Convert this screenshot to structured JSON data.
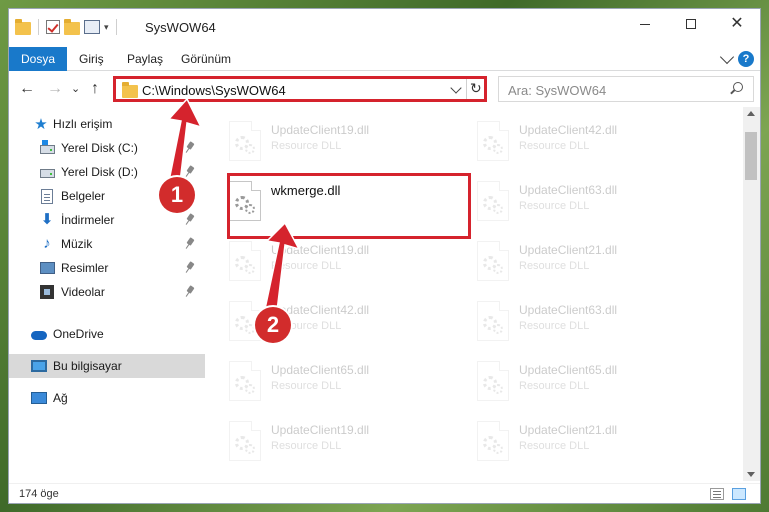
{
  "window": {
    "title": "SysWOW64",
    "qat_dropdown": "▾"
  },
  "ribbon": {
    "tabs": [
      {
        "label": "Dosya",
        "active": true
      },
      {
        "label": "Giriş",
        "active": false
      },
      {
        "label": "Paylaş",
        "active": false
      },
      {
        "label": "Görünüm",
        "active": false
      }
    ],
    "help": "?"
  },
  "nav": {
    "back": "←",
    "forward": "→",
    "recent": "⌄",
    "up": "↑",
    "address": "C:\\Windows\\SysWOW64",
    "refresh": "↻",
    "search_placeholder": "Ara: SysWOW64"
  },
  "sidebar": {
    "items": [
      {
        "label": "Hızlı erişim",
        "icon": "star-icon"
      },
      {
        "label": "Yerel Disk (C:)",
        "icon": "drive-icon",
        "pinned": true
      },
      {
        "label": "Yerel Disk (D:)",
        "icon": "drive-icon",
        "pinned": true
      },
      {
        "label": "Belgeler",
        "icon": "document-icon",
        "pinned": true
      },
      {
        "label": "İndirmeler",
        "icon": "download-icon",
        "pinned": true
      },
      {
        "label": "Müzik",
        "icon": "music-icon",
        "pinned": true
      },
      {
        "label": "Resimler",
        "icon": "pictures-icon",
        "pinned": true
      },
      {
        "label": "Videolar",
        "icon": "videos-icon",
        "pinned": true
      },
      {
        "label": "OneDrive",
        "icon": "cloud-icon"
      },
      {
        "label": "Bu bilgisayar",
        "icon": "computer-icon",
        "selected": true
      },
      {
        "label": "Ağ",
        "icon": "network-icon"
      }
    ]
  },
  "files": {
    "col1": [
      {
        "name": "UpdateClient19.dll",
        "type": "Resource DLL"
      },
      {
        "name": "wkmerge.dll",
        "type": ""
      },
      {
        "name": "UpdateClient19.dll",
        "type": "Resource DLL"
      },
      {
        "name": "UpdateClient42.dll",
        "type": "Resource DLL"
      },
      {
        "name": "UpdateClient65.dll",
        "type": "Resource DLL"
      },
      {
        "name": "UpdateClient19.dll",
        "type": "Resource DLL"
      }
    ],
    "col2": [
      {
        "name": "UpdateClient42.dll",
        "type": "Resource DLL"
      },
      {
        "name": "UpdateClient63.dll",
        "type": "Resource DLL"
      },
      {
        "name": "UpdateClient21.dll",
        "type": "Resource DLL"
      },
      {
        "name": "UpdateClient63.dll",
        "type": "Resource DLL"
      },
      {
        "name": "UpdateClient65.dll",
        "type": "Resource DLL"
      },
      {
        "name": "UpdateClient21.dll",
        "type": "Resource DLL"
      }
    ]
  },
  "status": {
    "count": "174 öge"
  },
  "annotations": {
    "step1": "1",
    "step2": "2",
    "color": "#d5232d"
  }
}
